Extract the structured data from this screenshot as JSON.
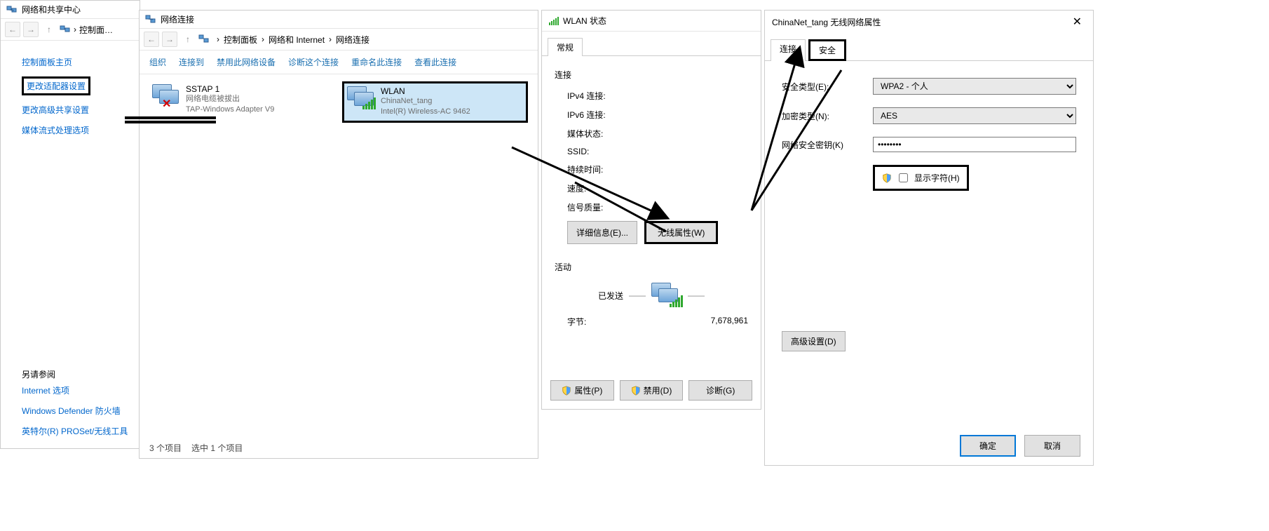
{
  "win1": {
    "title": "网络和共享中心",
    "breadcrumb": "控制面…",
    "sidebar": {
      "home": "控制面板主页",
      "adapter": "更改适配器设置",
      "advanced": "更改高级共享设置",
      "media": "媒体流式处理选项"
    },
    "see_also_h": "另请参阅",
    "see_also": [
      "Internet 选项",
      "Windows Defender 防火墙",
      "英特尔(R) PROSet/无线工具"
    ]
  },
  "win2": {
    "title": "网络连接",
    "breadcrumb": [
      "控制面板",
      "网络和 Internet",
      "网络连接"
    ],
    "toolbar": [
      "组织",
      "连接到",
      "禁用此网络设备",
      "诊断这个连接",
      "重命名此连接",
      "查看此连接"
    ],
    "adapters": [
      {
        "name": "SSTAP 1",
        "line2": "网络电缆被拔出",
        "line3": "TAP-Windows Adapter V9",
        "state": "disconnected"
      },
      {
        "name": "WLAN",
        "line2": "ChinaNet_tang",
        "line3": "Intel(R) Wireless-AC 9462",
        "state": "connected",
        "selected": true
      }
    ],
    "status": {
      "count": "3 个项目",
      "selected": "选中 1 个项目"
    }
  },
  "win3": {
    "title": "WLAN 状态",
    "tab_general": "常规",
    "group_conn": "连接",
    "rows": {
      "ipv4": "IPv4 连接:",
      "ipv6": "IPv6 连接:",
      "media": "媒体状态:",
      "ssid": "SSID:",
      "duration": "持续时间:",
      "speed": "速度:",
      "signal": "信号质量:"
    },
    "btn_details": "详细信息(E)...",
    "btn_wireless": "无线属性(W)",
    "group_act": "活动",
    "sent_label": "已发送",
    "bytes_label": "字节:",
    "bytes_sent": "7,678,961",
    "btn_props": "属性(P)",
    "btn_disable": "禁用(D)",
    "btn_diag": "诊断(G)"
  },
  "win4": {
    "title": "ChinaNet_tang 无线网络属性",
    "tab_conn": "连接",
    "tab_sec": "安全",
    "lbl_sectype": "安全类型(E):",
    "val_sectype": "WPA2 - 个人",
    "lbl_enc": "加密类型(N):",
    "val_enc": "AES",
    "lbl_key": "网络安全密钥(K)",
    "val_key": "••••••••",
    "chk_show": "显示字符(H)",
    "btn_adv": "高级设置(D)",
    "btn_ok": "确定",
    "btn_cancel": "取消"
  }
}
